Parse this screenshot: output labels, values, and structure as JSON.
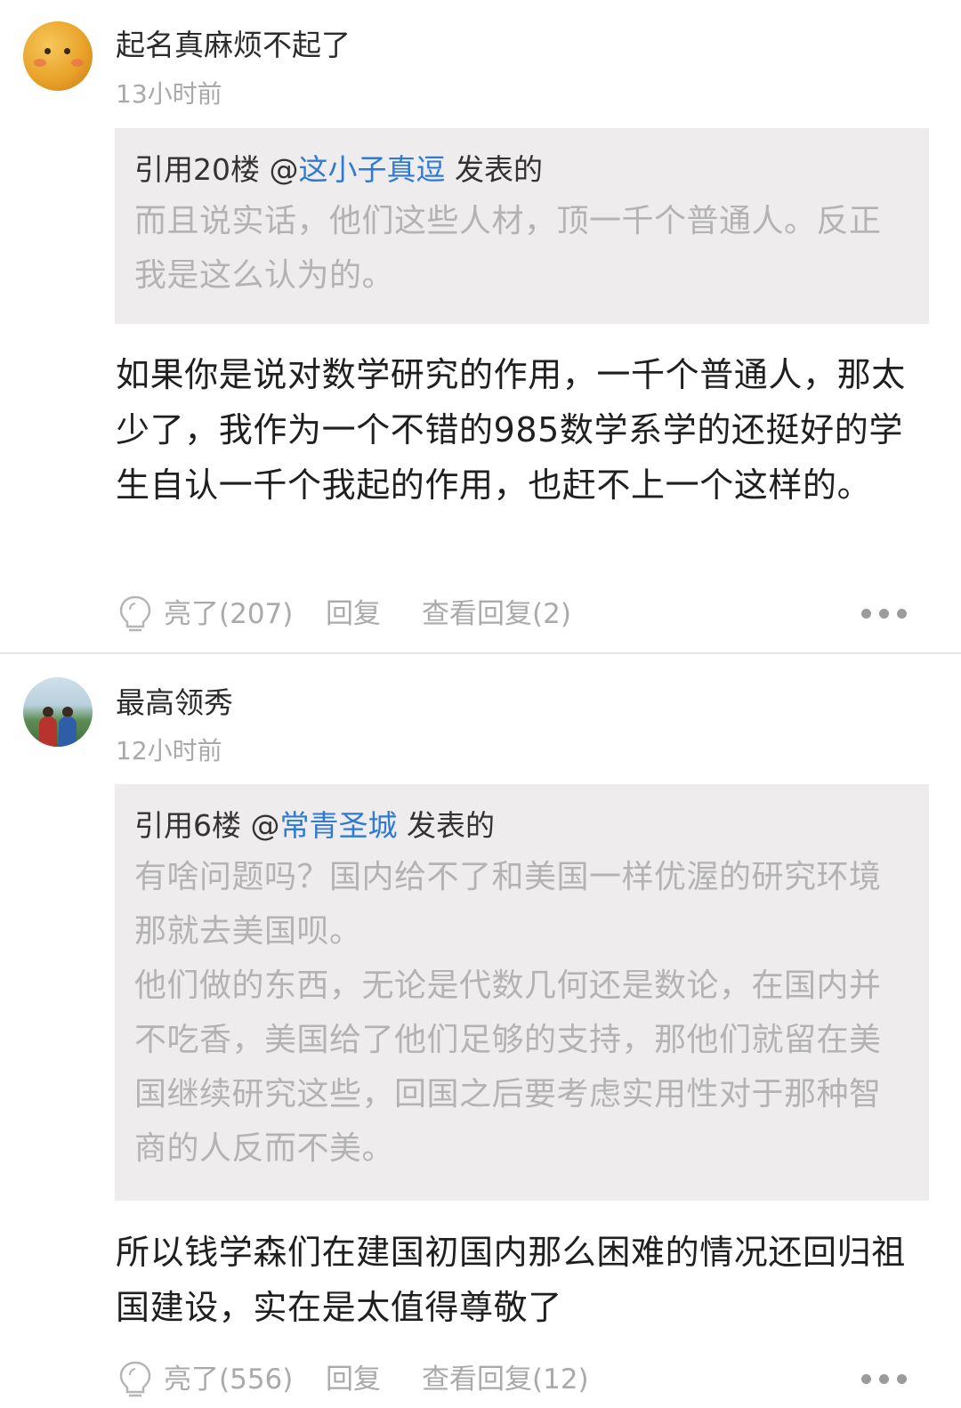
{
  "comments": [
    {
      "avatar_icon": "cartoon-face-avatar",
      "username": "起名真麻烦不起了",
      "timestamp": "13小时前",
      "quote": {
        "prefix": "引用20楼 @",
        "user": "这小子真逗",
        "suffix": " 发表的",
        "lines": [
          "而且说实话，他们这些人材，顶一千个普通人。反正我是这么认为的。"
        ]
      },
      "body": "如果你是说对数学研究的作用，一千个普通人，那太少了，我作为一个不错的985数学系学的还挺好的学生自认一千个我起的作用，也赶不上一个这样的。",
      "like_label": "亮了(207)",
      "reply_label": "回复",
      "view_replies_label": "查看回复(2)"
    },
    {
      "avatar_icon": "photo-avatar",
      "username": "最高领秀",
      "timestamp": "12小时前",
      "quote": {
        "prefix": "引用6楼 @",
        "user": "常青圣城",
        "suffix": " 发表的",
        "lines": [
          "有啥问题吗？国内给不了和美国一样优渥的研究环境那就去美国呗。",
          "他们做的东西，无论是代数几何还是数论，在国内并不吃香，美国给了他们足够的支持，那他们就留在美国继续研究这些，回国之后要考虑实用性对于那种智商的人反而不美。"
        ]
      },
      "body": "所以钱学森们在建国初国内那么困难的情况还回归祖国建设，实在是太值得尊敬了",
      "like_label": "亮了(556)",
      "reply_label": "回复",
      "view_replies_label": "查看回复(12)"
    }
  ],
  "colors": {
    "link_blue": "#2f7ad2",
    "quote_bg": "#efeced",
    "muted_text": "#aaaaaa"
  },
  "icons": {
    "like": "lightbulb-icon",
    "more": "more-dots-icon"
  }
}
